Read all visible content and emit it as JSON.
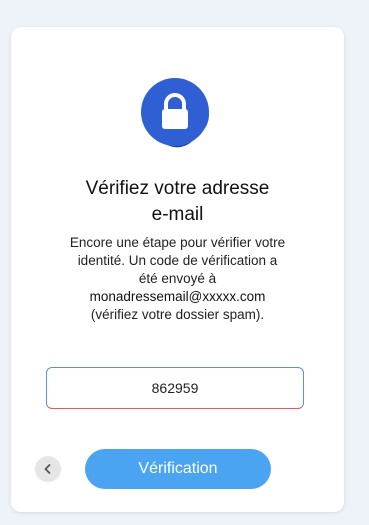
{
  "card": {
    "title_line1": "Vérifiez votre adresse",
    "title_line2": "e-mail",
    "desc_line1": "Encore une étape pour vérifier votre",
    "desc_line2": "identité. Un code de vérification a",
    "desc_line3": "été envoyé à",
    "email": "monadressemail@xxxxx.com",
    "desc_line5": "(vérifiez votre dossier spam).",
    "code_value": "862959",
    "verify_label": "Vérification",
    "back_icon": "chevron-left-icon",
    "lock_icon": "lock-icon"
  },
  "colors": {
    "page_bg": "#eef3f9",
    "badge_blue": "#2f5fd3",
    "button_blue": "#4ba4f2",
    "input_border": "#5f8fd8",
    "input_border_bottom": "#e05b5b"
  }
}
